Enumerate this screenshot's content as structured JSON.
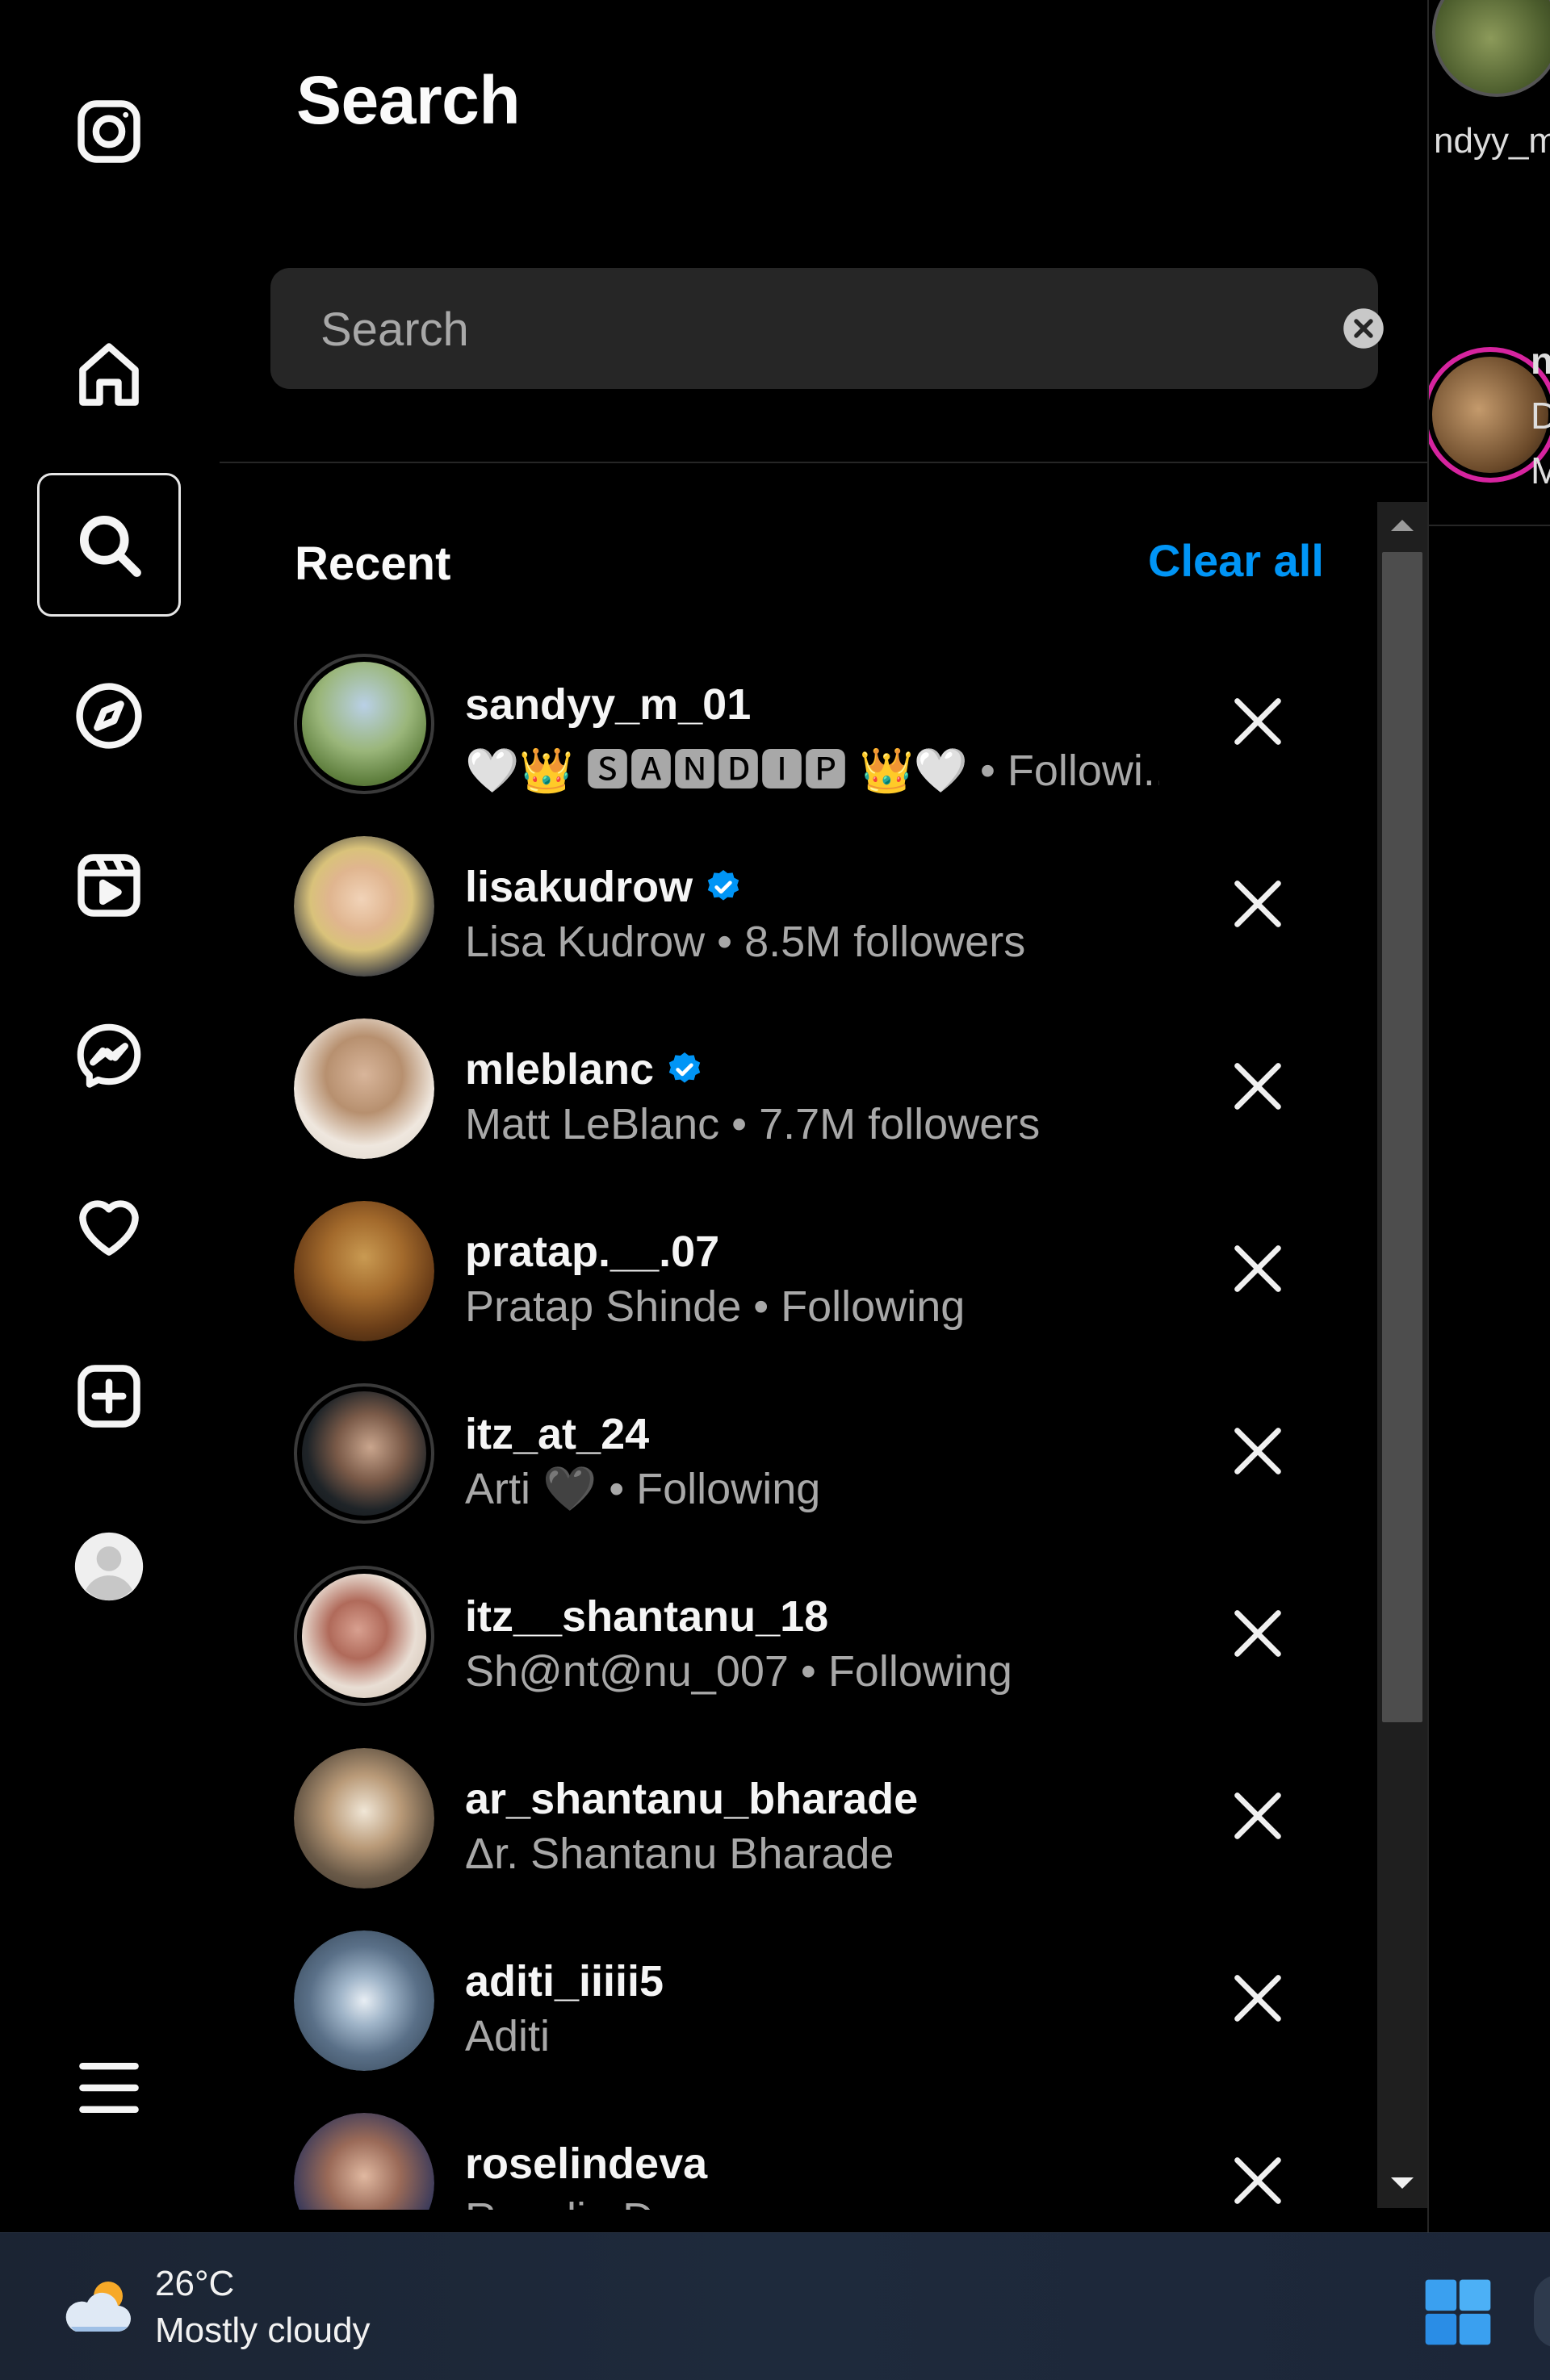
{
  "nav": {
    "items": [
      {
        "name": "instagram-logo-icon"
      },
      {
        "name": "home-icon"
      },
      {
        "name": "search-icon",
        "active": true
      },
      {
        "name": "explore-compass-icon"
      },
      {
        "name": "reels-icon"
      },
      {
        "name": "messenger-icon"
      },
      {
        "name": "notifications-heart-icon"
      },
      {
        "name": "create-plus-icon"
      },
      {
        "name": "profile-avatar-icon"
      },
      {
        "name": "more-menu-icon"
      }
    ]
  },
  "search": {
    "title": "Search",
    "placeholder": "Search",
    "value": "",
    "recent_label": "Recent",
    "clear_all_label": "Clear all",
    "accent_color": "#0095f6"
  },
  "recent": [
    {
      "username": "sandyy_m_01",
      "subtitle": "🤍👑 🆂🅰🅽🅳🅸🅿 👑🤍 • Followi...",
      "verified": false,
      "ringed": true
    },
    {
      "username": "lisakudrow",
      "subtitle": "Lisa Kudrow • 8.5M followers",
      "verified": true,
      "ringed": false
    },
    {
      "username": "mleblanc",
      "subtitle": "Matt LeBlanc • 7.7M followers",
      "verified": true,
      "ringed": false
    },
    {
      "username": "pratap.__.07",
      "subtitle": "Pratap Shinde • Following",
      "verified": false,
      "ringed": false
    },
    {
      "username": "itz_at_24",
      "subtitle": "Arti 🖤 • Following",
      "verified": false,
      "ringed": true
    },
    {
      "username": "itz__shantanu_18",
      "subtitle": "Sh@nt@nu_007 • Following",
      "verified": false,
      "ringed": true
    },
    {
      "username": "ar_shantanu_bharade",
      "subtitle": "Δr. Shantanu Bharade",
      "verified": false,
      "ringed": false
    },
    {
      "username": "aditi_iiiii5",
      "subtitle": "Aditi",
      "verified": false,
      "ringed": false
    },
    {
      "username": "roselindeva",
      "subtitle": "Roselin D...",
      "verified": false,
      "ringed": false
    }
  ],
  "background_peek": {
    "story_name": "ndyy_m_",
    "post_lines": [
      "n",
      "D",
      "M"
    ]
  },
  "taskbar": {
    "temperature": "26°C",
    "condition": "Mostly cloudy",
    "weather_icon": "partly-cloudy-icon",
    "start_icon": "windows-start-icon"
  }
}
